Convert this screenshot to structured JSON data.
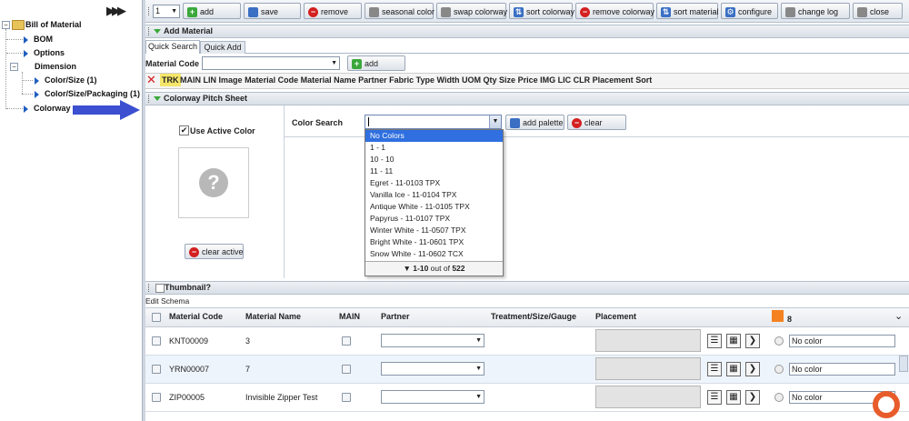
{
  "tree": {
    "root": "Bill of Material",
    "items": [
      "BOM",
      "Options",
      "Dimension",
      "Color/Size (1)",
      "Color/Size/Packaging (1)",
      "Colorway"
    ]
  },
  "toolbar": {
    "page_value": "1",
    "add": "add",
    "save": "save",
    "remove": "remove",
    "seasonal_color": "seasonal color",
    "swap_colorway": "swap colorway",
    "sort_colorway": "sort colorway",
    "remove_colorway": "remove colorway",
    "sort_material": "sort material",
    "configure": "configure",
    "change_log": "change log",
    "close": "close"
  },
  "add_material": {
    "title": "Add Material",
    "tabs": [
      "Quick Search",
      "Quick Add"
    ],
    "material_code_label": "Material Code",
    "material_code_value": "",
    "add_label": "add",
    "columns": [
      "TRK",
      "MAIN",
      "LIN",
      "Image",
      "Material Code",
      "Material Name",
      "Partner",
      "Fabric Type",
      "Width",
      "UOM",
      "Qty",
      "Size",
      "Price",
      "IMG",
      "LIC",
      "CLR",
      "Placement",
      "Sort"
    ]
  },
  "pitch_sheet": {
    "title": "Colorway Pitch Sheet",
    "use_active_color_label": "Use Active Color",
    "use_active_color_checked": true,
    "clear_active_label": "clear active",
    "color_search_label": "Color Search",
    "add_palette_label": "add palette",
    "clear_label": "clear",
    "dropdown_options": [
      "No Colors",
      "1 - 1",
      "10 - 10",
      "11 - 11",
      "Egret - 11-0103 TPX",
      "Vanilla Ice - 11-0104 TPX",
      "Antique White - 11-0105 TPX",
      "Papyrus - 11-0107 TPX",
      "Winter White - 11-0507 TPX",
      "Bright White - 11-0601 TPX",
      "Snow White - 11-0602 TCX"
    ],
    "pager_prefix": "1-10",
    "pager_mid": "out of",
    "pager_total": "522"
  },
  "thumbnail": {
    "label": "Thumbnail?",
    "edit_schema": "Edit Schema"
  },
  "grid": {
    "headers": {
      "material_code": "Material Code",
      "material_name": "Material Name",
      "main": "MAIN",
      "partner": "Partner",
      "treatment": "Treatment/Size/Gauge",
      "placement": "Placement",
      "colorway_number": "8"
    },
    "colorway_swatch_color": "#f58220",
    "rows": [
      {
        "code": "KNT00009",
        "name": "3",
        "color": "No color"
      },
      {
        "code": "YRN00007",
        "name": "7",
        "color": "No color"
      },
      {
        "code": "ZIP00005",
        "name": "Invisible Zipper Test",
        "color": "No color"
      }
    ]
  },
  "colors": {
    "accent": "#2f6fe0",
    "arrow": "#3b4fd0"
  }
}
